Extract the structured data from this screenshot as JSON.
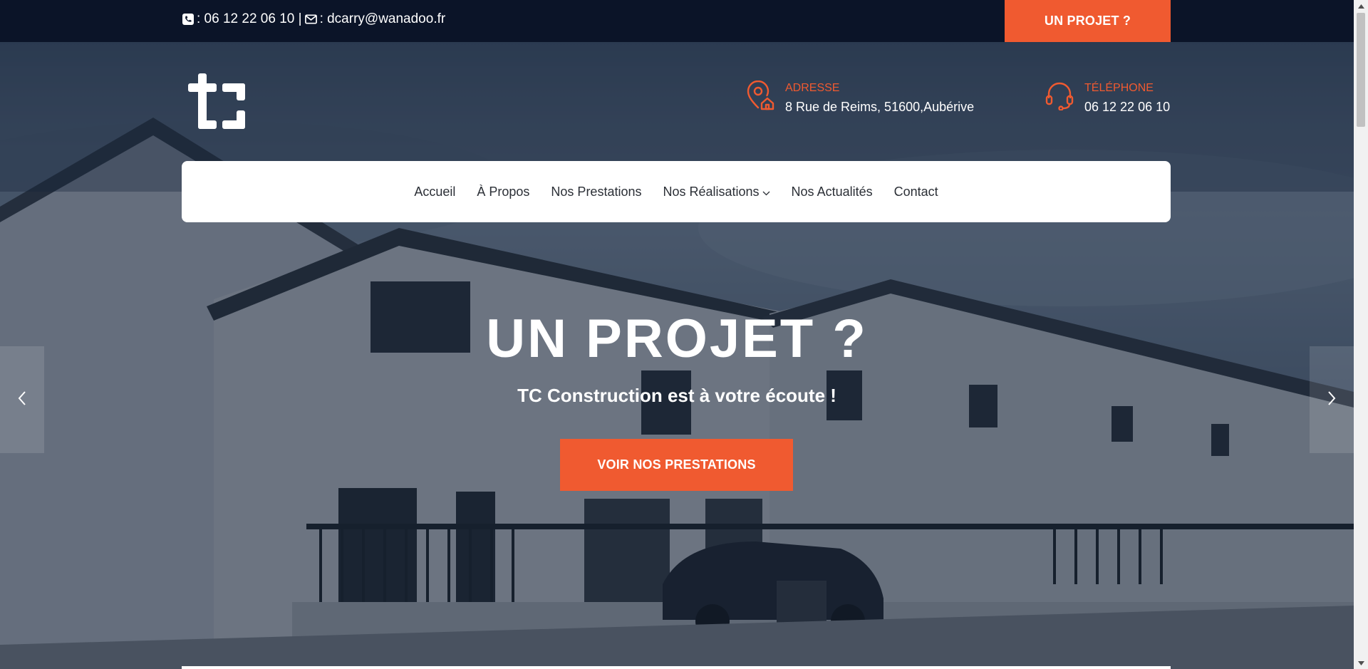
{
  "topbar": {
    "contact_text": ": 06 12 22 06 10 | ",
    "email_text": ": dcarry@wanadoo.fr",
    "cta_label": "UN PROJET ?"
  },
  "brand": {
    "logo_alt": "tc"
  },
  "info": {
    "address_label": "ADRESSE",
    "address_value": "8 Rue de Reims, 51600,Aubérive",
    "phone_label": "TÉLÉPHONE",
    "phone_value": "06 12 22 06 10"
  },
  "nav": {
    "items": [
      {
        "label": "Accueil"
      },
      {
        "label": "À Propos"
      },
      {
        "label": "Nos Prestations"
      },
      {
        "label": "Nos Réalisations",
        "has_dropdown": true
      },
      {
        "label": "Nos Actualités"
      },
      {
        "label": "Contact"
      }
    ]
  },
  "hero": {
    "title": "UN PROJET ?",
    "subtitle": "TC Construction est à votre écoute !",
    "button_label": "VOIR NOS PRESTATIONS"
  },
  "colors": {
    "accent": "#f05a30",
    "topbar_bg": "#0b1428",
    "nav_bg": "#ffffff",
    "text_light": "#ffffff"
  },
  "icons": {
    "phone": "phone-square-icon",
    "email": "envelope-icon",
    "address": "map-pin-home-icon",
    "telephone": "headset-icon",
    "prev": "chevron-left-icon",
    "next": "chevron-right-icon",
    "dropdown": "chevron-down-icon"
  }
}
